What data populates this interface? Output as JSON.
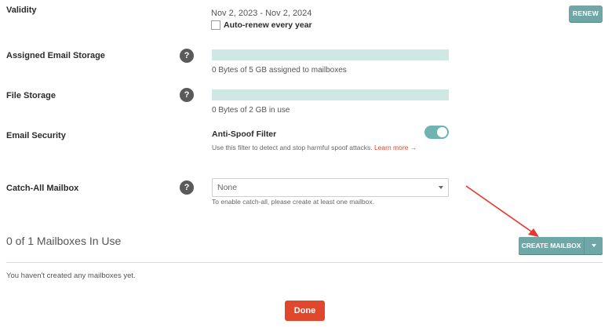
{
  "validity": {
    "label": "Validity",
    "dates": "Nov 2, 2023 - Nov 2, 2024",
    "auto_renew_label": "Auto-renew every year",
    "renew_button": "RENEW"
  },
  "email_storage": {
    "label": "Assigned Email Storage",
    "help": "?",
    "usage_fraction": 0,
    "usage_text": "0 Bytes of 5 GB assigned to mailboxes"
  },
  "file_storage": {
    "label": "File Storage",
    "help": "?",
    "usage_fraction": 0,
    "usage_text": "0 Bytes of 2 GB in use"
  },
  "email_security": {
    "label": "Email Security",
    "filter_title": "Anti-Spoof Filter",
    "enabled": true,
    "description": "Use this filter to detect and stop harmful spoof attacks.",
    "learn_more": "Learn more →"
  },
  "catch_all": {
    "label": "Catch-All Mailbox",
    "help": "?",
    "selected": "None",
    "hint": "To enable catch-all, please create at least one mailbox."
  },
  "mailboxes": {
    "heading": "0 of 1 Mailboxes In Use",
    "create_button": "CREATE MAILBOX",
    "empty_message": "You haven't created any mailboxes yet."
  },
  "footer": {
    "done_button": "Done"
  },
  "colors": {
    "accent": "#6ea7a6",
    "storage_bar": "#cfe7e5",
    "done": "#e0472d",
    "annotation_arrow": "#e8352f"
  }
}
